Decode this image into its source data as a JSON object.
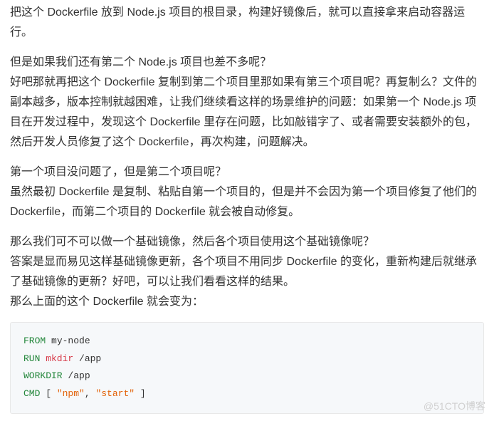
{
  "paragraphs": {
    "p1": "把这个 Dockerfile 放到 Node.js 项目的根目录，构建好镜像后，就可以直接拿来启动容器运行。",
    "p2a": "但是如果我们还有第二个 Node.js 项目也差不多呢？",
    "p2b": "好吧那就再把这个 Dockerfile 复制到第二个项目里那如果有第三个项目呢？再复制么？文件的副本越多，版本控制就越困难，让我们继续看这样的场景维护的问题：如果第一个 Node.js 项目在开发过程中，发现这个 Dockerfile 里存在问题，比如敲错字了、或者需要安装额外的包，然后开发人员修复了这个 Dockerfile，再次构建，问题解决。",
    "p3a": "第一个项目没问题了，但是第二个项目呢？",
    "p3b": "虽然最初 Dockerfile 是复制、粘贴自第一个项目的，但是并不会因为第一个项目修复了他们的 Dockerfile，而第二个项目的 Dockerfile 就会被自动修复。",
    "p4a": "那么我们可不可以做一个基础镜像，然后各个项目使用这个基础镜像呢？",
    "p4b": "答案是显而易见这样基础镜像更新，各个项目不用同步 Dockerfile 的变化，重新构建后就继承了基础镜像的更新？好吧，可以让我们看看这样的结果。",
    "p4c": "那么上面的这个 Dockerfile 就会变为："
  },
  "code": {
    "line1": {
      "kw": "FROM",
      "val": " my-node"
    },
    "line2": {
      "kw": "RUN",
      "cmd": " mkdir",
      "arg": " /app"
    },
    "line3": {
      "kw": "WORKDIR",
      "arg": " /app"
    },
    "line4": {
      "kw": "CMD",
      "b1": " [ ",
      "s1": "\"npm\"",
      "c": ", ",
      "s2": "\"start\"",
      "b2": " ]"
    }
  },
  "watermark": "@51CTO博客"
}
